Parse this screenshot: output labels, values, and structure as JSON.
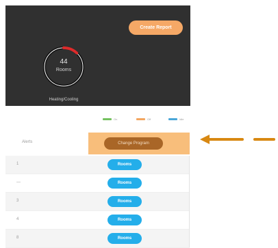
{
  "header_panel": {
    "create_report_label": "Create Report",
    "gauge": {
      "value": "44",
      "unit": "Rooms",
      "caption": "Heating/Cooling",
      "fraction_red": 0.12,
      "track_color": "#111111",
      "ring_color": "#ffffff",
      "accent_color": "#dd2b2b"
    }
  },
  "legend": {
    "items": [
      {
        "label": "On",
        "color": "#74c15f"
      },
      {
        "label": "Off",
        "color": "#f3a660"
      },
      {
        "label": "Idle",
        "color": "#49a6d8"
      }
    ]
  },
  "table": {
    "alerts_label": "Alerts",
    "highlight_button_label": "Change Program",
    "rows": [
      {
        "index": "1",
        "button_label": "Rooms"
      },
      {
        "index": "—",
        "button_label": "Rooms"
      },
      {
        "index": "3",
        "button_label": "Rooms"
      },
      {
        "index": "4",
        "button_label": "Rooms"
      },
      {
        "index": "8",
        "button_label": "Rooms"
      }
    ]
  },
  "annotation": {
    "arrow_color": "#d88812"
  }
}
